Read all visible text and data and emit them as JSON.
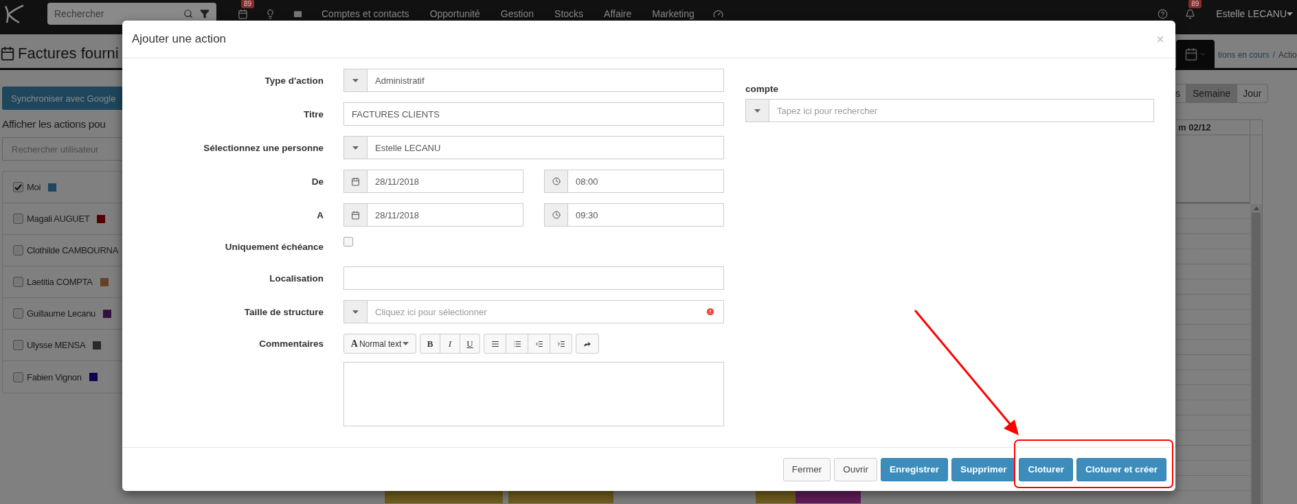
{
  "navbar": {
    "search_placeholder": "Rechercher",
    "calendar_badge": "89",
    "menu": [
      "Comptes et contacts",
      "Opportunité",
      "Gestion",
      "Stocks",
      "Affaire",
      "Marketing"
    ],
    "notification_badge": "89",
    "user": "Estelle LECANU"
  },
  "page": {
    "title": "Factures fourni",
    "sync_button": "Synchroniser avec Google",
    "filter_heading": "Afficher les actions pou",
    "user_search_placeholder": "Rechercher utilisateur",
    "users": [
      {
        "name": "Moi",
        "checked": true,
        "color": "#1e4660"
      },
      {
        "name": "Magali AUGUET",
        "checked": false,
        "color": "#540000"
      },
      {
        "name": "Clothilde CAMBOURNA",
        "checked": false
      },
      {
        "name": "Laetitia COMPTA",
        "checked": false,
        "color": "#644126"
      },
      {
        "name": "Guillaume Lecanu",
        "checked": false,
        "color": "#350e42"
      },
      {
        "name": "Ulysse MENSA",
        "checked": false,
        "color": "#282828"
      },
      {
        "name": "Fabien Vignon",
        "checked": false,
        "color": "#12004e"
      }
    ],
    "breadcrumb": [
      "tions en cours",
      "/",
      "Actio"
    ],
    "view_buttons": [
      {
        "label": "s",
        "selected": false
      },
      {
        "label": "Semaine",
        "selected": true
      },
      {
        "label": "Jour",
        "selected": false
      }
    ],
    "calendar_header": "m 02/12"
  },
  "dialog": {
    "title": "Ajouter une action",
    "close": "×",
    "fields": [
      {
        "kind": "select",
        "label": "Type d'action",
        "value": "Administratif"
      },
      {
        "kind": "text",
        "label": "Titre",
        "value": "FACTURES CLIENTS"
      },
      {
        "kind": "select",
        "label": "Sélectionnez une personne",
        "value": "Estelle LECANU"
      },
      {
        "kind": "datetime",
        "label": "De",
        "date": "28/11/2018",
        "time": "08:00"
      },
      {
        "kind": "datetime",
        "label": "A",
        "date": "28/11/2018",
        "time": "09:30"
      },
      {
        "kind": "checkbox",
        "label": "Uniquement échéance",
        "checked": false
      },
      {
        "kind": "text",
        "label": "Localisation"
      },
      {
        "kind": "select",
        "label": "Taille de structure",
        "placeholder": "Cliquez ici pour sélectionner",
        "invalid": true
      },
      {
        "kind": "editor",
        "label": "Commentaires",
        "style_icon": "A",
        "style_menu": "Normal text",
        "format_buttons": [
          "B",
          "I",
          "U"
        ]
      }
    ],
    "account": {
      "label": "compte",
      "placeholder": "Tapez ici pour rechercher"
    },
    "buttons": [
      {
        "label": "Fermer",
        "kind": "default"
      },
      {
        "label": "Ouvrir",
        "kind": "default"
      },
      {
        "label": "Enregistrer",
        "kind": "primary"
      },
      {
        "label": "Supprimer",
        "kind": "primary"
      },
      {
        "label": "Cloturer",
        "kind": "primary"
      },
      {
        "label": "Cloturer et créer",
        "kind": "primary"
      }
    ]
  }
}
